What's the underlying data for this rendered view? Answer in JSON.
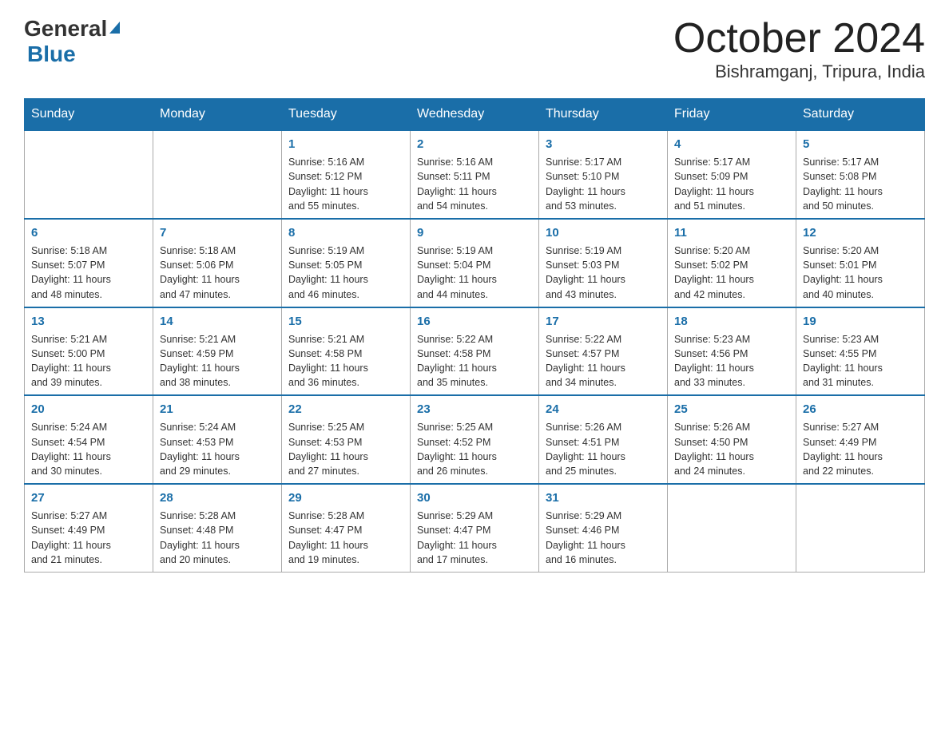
{
  "logo": {
    "general": "General",
    "blue": "Blue",
    "triangle_color": "#1a6ea8"
  },
  "title": {
    "month": "October 2024",
    "location": "Bishramganj, Tripura, India"
  },
  "weekdays": [
    "Sunday",
    "Monday",
    "Tuesday",
    "Wednesday",
    "Thursday",
    "Friday",
    "Saturday"
  ],
  "weeks": [
    [
      {
        "day": "",
        "info": ""
      },
      {
        "day": "",
        "info": ""
      },
      {
        "day": "1",
        "info": "Sunrise: 5:16 AM\nSunset: 5:12 PM\nDaylight: 11 hours\nand 55 minutes."
      },
      {
        "day": "2",
        "info": "Sunrise: 5:16 AM\nSunset: 5:11 PM\nDaylight: 11 hours\nand 54 minutes."
      },
      {
        "day": "3",
        "info": "Sunrise: 5:17 AM\nSunset: 5:10 PM\nDaylight: 11 hours\nand 53 minutes."
      },
      {
        "day": "4",
        "info": "Sunrise: 5:17 AM\nSunset: 5:09 PM\nDaylight: 11 hours\nand 51 minutes."
      },
      {
        "day": "5",
        "info": "Sunrise: 5:17 AM\nSunset: 5:08 PM\nDaylight: 11 hours\nand 50 minutes."
      }
    ],
    [
      {
        "day": "6",
        "info": "Sunrise: 5:18 AM\nSunset: 5:07 PM\nDaylight: 11 hours\nand 48 minutes."
      },
      {
        "day": "7",
        "info": "Sunrise: 5:18 AM\nSunset: 5:06 PM\nDaylight: 11 hours\nand 47 minutes."
      },
      {
        "day": "8",
        "info": "Sunrise: 5:19 AM\nSunset: 5:05 PM\nDaylight: 11 hours\nand 46 minutes."
      },
      {
        "day": "9",
        "info": "Sunrise: 5:19 AM\nSunset: 5:04 PM\nDaylight: 11 hours\nand 44 minutes."
      },
      {
        "day": "10",
        "info": "Sunrise: 5:19 AM\nSunset: 5:03 PM\nDaylight: 11 hours\nand 43 minutes."
      },
      {
        "day": "11",
        "info": "Sunrise: 5:20 AM\nSunset: 5:02 PM\nDaylight: 11 hours\nand 42 minutes."
      },
      {
        "day": "12",
        "info": "Sunrise: 5:20 AM\nSunset: 5:01 PM\nDaylight: 11 hours\nand 40 minutes."
      }
    ],
    [
      {
        "day": "13",
        "info": "Sunrise: 5:21 AM\nSunset: 5:00 PM\nDaylight: 11 hours\nand 39 minutes."
      },
      {
        "day": "14",
        "info": "Sunrise: 5:21 AM\nSunset: 4:59 PM\nDaylight: 11 hours\nand 38 minutes."
      },
      {
        "day": "15",
        "info": "Sunrise: 5:21 AM\nSunset: 4:58 PM\nDaylight: 11 hours\nand 36 minutes."
      },
      {
        "day": "16",
        "info": "Sunrise: 5:22 AM\nSunset: 4:58 PM\nDaylight: 11 hours\nand 35 minutes."
      },
      {
        "day": "17",
        "info": "Sunrise: 5:22 AM\nSunset: 4:57 PM\nDaylight: 11 hours\nand 34 minutes."
      },
      {
        "day": "18",
        "info": "Sunrise: 5:23 AM\nSunset: 4:56 PM\nDaylight: 11 hours\nand 33 minutes."
      },
      {
        "day": "19",
        "info": "Sunrise: 5:23 AM\nSunset: 4:55 PM\nDaylight: 11 hours\nand 31 minutes."
      }
    ],
    [
      {
        "day": "20",
        "info": "Sunrise: 5:24 AM\nSunset: 4:54 PM\nDaylight: 11 hours\nand 30 minutes."
      },
      {
        "day": "21",
        "info": "Sunrise: 5:24 AM\nSunset: 4:53 PM\nDaylight: 11 hours\nand 29 minutes."
      },
      {
        "day": "22",
        "info": "Sunrise: 5:25 AM\nSunset: 4:53 PM\nDaylight: 11 hours\nand 27 minutes."
      },
      {
        "day": "23",
        "info": "Sunrise: 5:25 AM\nSunset: 4:52 PM\nDaylight: 11 hours\nand 26 minutes."
      },
      {
        "day": "24",
        "info": "Sunrise: 5:26 AM\nSunset: 4:51 PM\nDaylight: 11 hours\nand 25 minutes."
      },
      {
        "day": "25",
        "info": "Sunrise: 5:26 AM\nSunset: 4:50 PM\nDaylight: 11 hours\nand 24 minutes."
      },
      {
        "day": "26",
        "info": "Sunrise: 5:27 AM\nSunset: 4:49 PM\nDaylight: 11 hours\nand 22 minutes."
      }
    ],
    [
      {
        "day": "27",
        "info": "Sunrise: 5:27 AM\nSunset: 4:49 PM\nDaylight: 11 hours\nand 21 minutes."
      },
      {
        "day": "28",
        "info": "Sunrise: 5:28 AM\nSunset: 4:48 PM\nDaylight: 11 hours\nand 20 minutes."
      },
      {
        "day": "29",
        "info": "Sunrise: 5:28 AM\nSunset: 4:47 PM\nDaylight: 11 hours\nand 19 minutes."
      },
      {
        "day": "30",
        "info": "Sunrise: 5:29 AM\nSunset: 4:47 PM\nDaylight: 11 hours\nand 17 minutes."
      },
      {
        "day": "31",
        "info": "Sunrise: 5:29 AM\nSunset: 4:46 PM\nDaylight: 11 hours\nand 16 minutes."
      },
      {
        "day": "",
        "info": ""
      },
      {
        "day": "",
        "info": ""
      }
    ]
  ]
}
